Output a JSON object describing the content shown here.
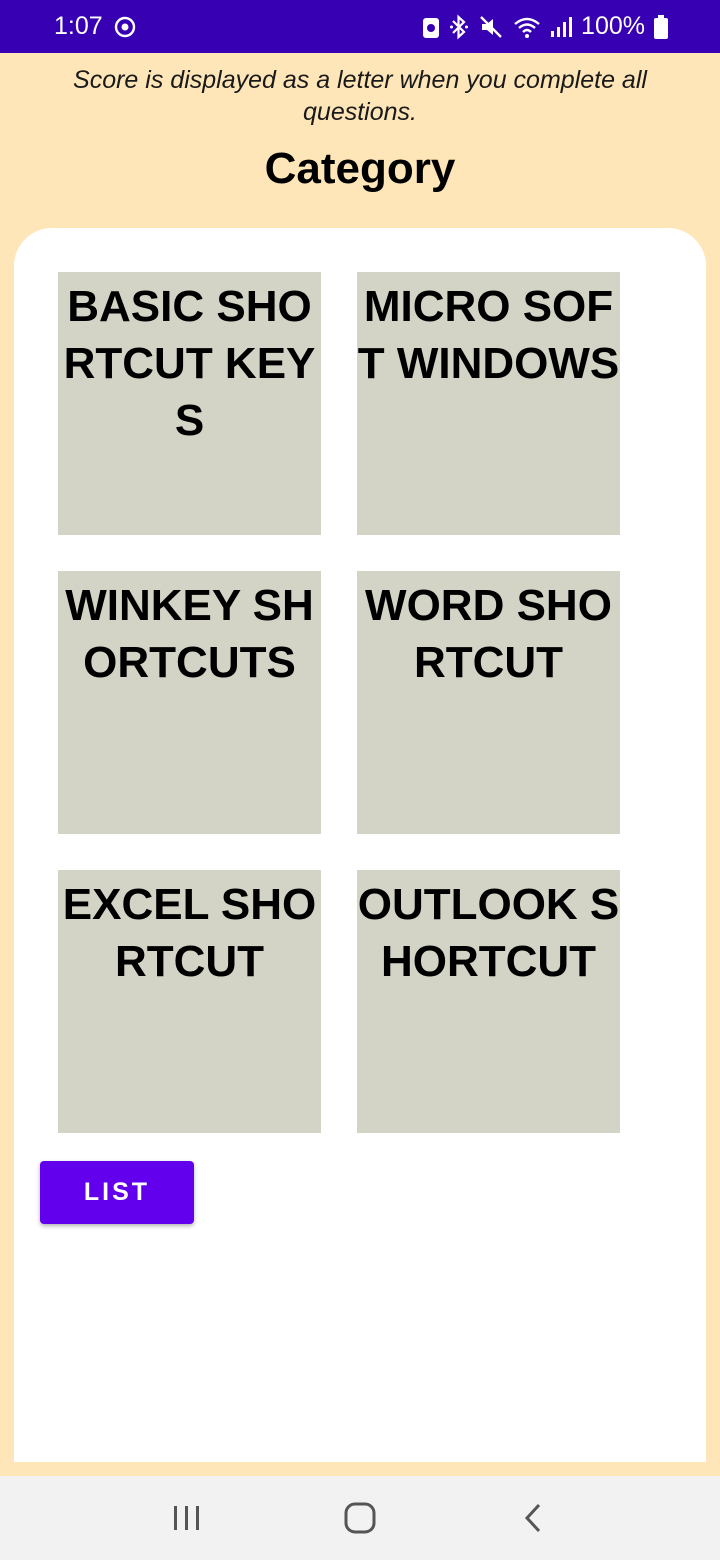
{
  "status_bar": {
    "time": "1:07",
    "battery": "100%",
    "icons": [
      "sync-icon",
      "battery-saver-icon",
      "bluetooth-icon",
      "mute-icon",
      "wifi-icon",
      "signal-icon",
      "battery-icon"
    ]
  },
  "header": {
    "subtitle": "Score is displayed as a letter when you complete all questions.",
    "title": "Category"
  },
  "categories": [
    {
      "label": "BASIC SHORTCUT KEYS"
    },
    {
      "label": "MICRO SOFT WINDOWS"
    },
    {
      "label": "WINKEY SHORTCUTS"
    },
    {
      "label": "WORD SHORTCUT"
    },
    {
      "label": "EXCEL SHORTCUT"
    },
    {
      "label": "OUTLOOK SHORTCUT"
    }
  ],
  "list_button": {
    "label": "LIST"
  },
  "colors": {
    "status_bar": "#3700b3",
    "background": "#ffe6b8",
    "tile": "#d3d4c6",
    "button": "#6200ee"
  },
  "nav_bar": {
    "icons": [
      "recent-apps-icon",
      "home-icon",
      "back-icon"
    ]
  }
}
